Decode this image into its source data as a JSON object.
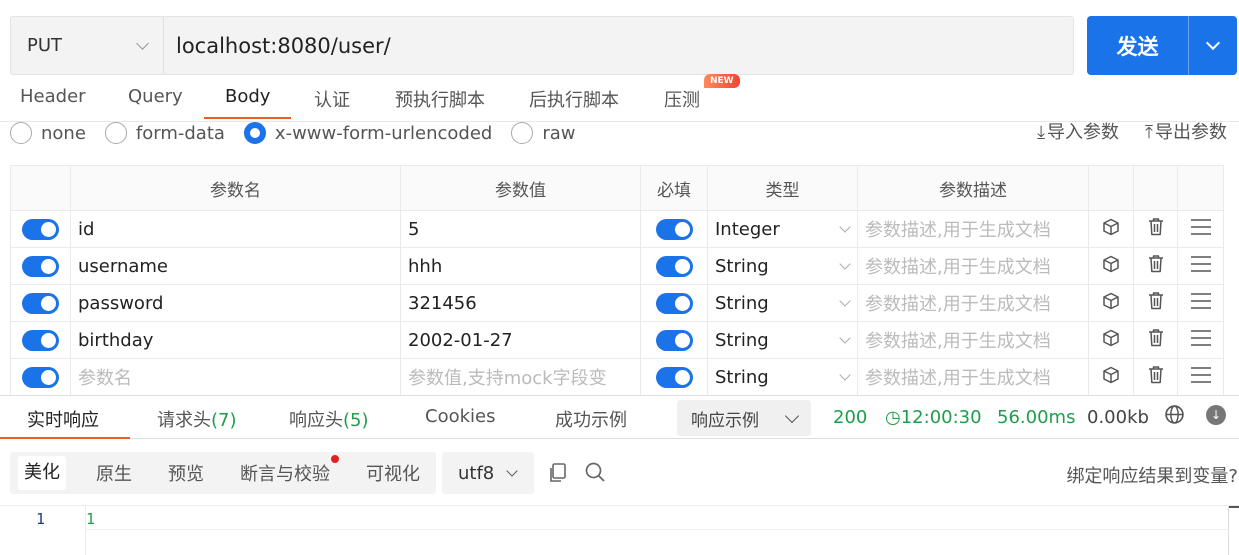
{
  "request": {
    "method": "PUT",
    "url": "localhost:8080/user/",
    "send_label": "发送"
  },
  "req_tabs": [
    {
      "label": "Header"
    },
    {
      "label": "Query"
    },
    {
      "label": "Body"
    },
    {
      "label": "认证"
    },
    {
      "label": "预执行脚本"
    },
    {
      "label": "后执行脚本"
    },
    {
      "label": "压测"
    }
  ],
  "new_badge": "NEW",
  "body_types": [
    {
      "label": "none"
    },
    {
      "label": "form-data"
    },
    {
      "label": "x-www-form-urlencoded"
    },
    {
      "label": "raw"
    }
  ],
  "param_actions": {
    "import": "导入参数",
    "export": "导出参数"
  },
  "table": {
    "headers": [
      "参数名",
      "参数值",
      "必填",
      "类型",
      "参数描述"
    ],
    "rows": [
      {
        "name": "id",
        "value": "5",
        "type": "Integer",
        "desc": "参数描述,用于生成文档"
      },
      {
        "name": "username",
        "value": "hhh",
        "type": "String",
        "desc": "参数描述,用于生成文档"
      },
      {
        "name": "password",
        "value": "321456",
        "type": "String",
        "desc": "参数描述,用于生成文档"
      },
      {
        "name": "birthday",
        "value": "2002-01-27",
        "type": "String",
        "desc": "参数描述,用于生成文档"
      }
    ],
    "new_row": {
      "name_placeholder": "参数名",
      "value_placeholder": "参数值,支持mock字段变",
      "type": "String",
      "desc_placeholder": "参数描述,用于生成文档"
    }
  },
  "response": {
    "tabs": [
      {
        "label": "实时响应",
        "count": ""
      },
      {
        "label": "请求头",
        "count": "(7)"
      },
      {
        "label": "响应头",
        "count": "(5)"
      },
      {
        "label": "Cookies",
        "count": ""
      },
      {
        "label": "成功示例",
        "count": ""
      }
    ],
    "example_select": "响应示例",
    "status": "200",
    "time": "12:00:30",
    "duration": "56.00ms",
    "size": "0.00kb",
    "view_modes": [
      "美化",
      "原生",
      "预览",
      "断言与校验",
      "可视化"
    ],
    "encoding": "utf8",
    "bind_link": "绑定响应结果到变量?",
    "code": {
      "line_number": "1",
      "content": "1"
    }
  },
  "colors": {
    "accent": "#1a73e8",
    "tab_underline": "#f15a24",
    "success": "#1e9e4a"
  }
}
